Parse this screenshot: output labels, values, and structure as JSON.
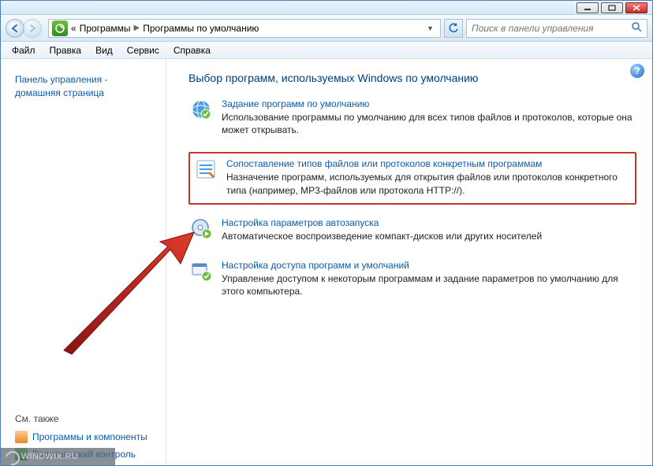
{
  "titlebar": {},
  "nav": {
    "back_chevrons": "«",
    "crumb1": "Программы",
    "crumb2": "Программы по умолчанию",
    "search_placeholder": "Поиск в панели управления"
  },
  "menu": {
    "file": "Файл",
    "edit": "Правка",
    "view": "Вид",
    "tools": "Сервис",
    "help": "Справка"
  },
  "sidebar": {
    "home_line1": "Панель управления -",
    "home_line2": "домашняя страница",
    "see_also": "См. также",
    "link1": "Программы и компоненты",
    "link2": "Родительский контроль"
  },
  "page": {
    "title": "Выбор программ, используемых Windows по умолчанию",
    "help": "?",
    "options": [
      {
        "link": "Задание программ по умолчанию",
        "desc": "Использование программы по умолчанию для всех типов файлов и протоколов, которые она может открывать."
      },
      {
        "link": "Сопоставление типов файлов или протоколов конкретным программам",
        "desc": "Назначение программ, используемых для открытия файлов или протоколов конкретного типа (например, MP3-файлов  или протокола HTTP://)."
      },
      {
        "link": "Настройка параметров автозапуска",
        "desc": "Автоматическое воспроизведение компакт-дисков или других носителей"
      },
      {
        "link": "Настройка доступа программ и умолчаний",
        "desc": "Управление доступом к некоторым программам и задание параметров по умолчанию для этого компьютера."
      }
    ]
  },
  "watermark": "WINDWIX.RU"
}
